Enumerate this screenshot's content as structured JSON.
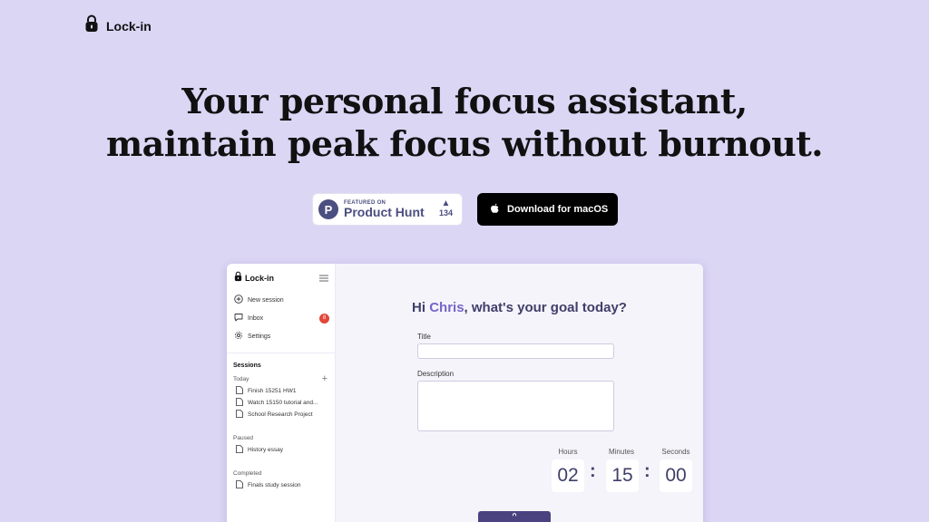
{
  "brand": {
    "name": "Lock-in",
    "icon": "lock-icon"
  },
  "hero": {
    "line1": "Your personal focus assistant,",
    "line2": "maintain peak focus without burnout."
  },
  "product_hunt": {
    "featured_label": "FEATURED ON",
    "name": "Product Hunt",
    "logo_letter": "P",
    "votes": "134"
  },
  "download": {
    "label": "Download for macOS",
    "icon": "apple-icon"
  },
  "app": {
    "brand": "Lock-in",
    "nav": [
      {
        "label": "New session",
        "icon": "plus-circle-icon"
      },
      {
        "label": "Inbox",
        "icon": "chat-icon",
        "badge": "8"
      },
      {
        "label": "Settings",
        "icon": "gear-icon"
      }
    ],
    "sessions_title": "Sessions",
    "groups": {
      "today": {
        "label": "Today",
        "items": [
          "Finish 15251 HW1",
          "Watch 15150 tutorial and...",
          "School Research Project"
        ]
      },
      "paused": {
        "label": "Paused",
        "items": [
          "History essay"
        ]
      },
      "completed": {
        "label": "Completed",
        "items": [
          "Finals study session"
        ]
      }
    },
    "greeting": {
      "prefix": "Hi ",
      "name": "Chris",
      "suffix": ", what's your goal today?"
    },
    "form": {
      "title_label": "Title",
      "description_label": "Description"
    },
    "timer": {
      "hours_label": "Hours",
      "minutes_label": "Minutes",
      "seconds_label": "Seconds",
      "hours": "02",
      "minutes": "15",
      "seconds": "00",
      "separator": ":"
    }
  },
  "colors": {
    "background": "#dcd6f5",
    "accent": "#7566c9",
    "button_dark": "#4b4380",
    "badge_red": "#e2473a"
  }
}
